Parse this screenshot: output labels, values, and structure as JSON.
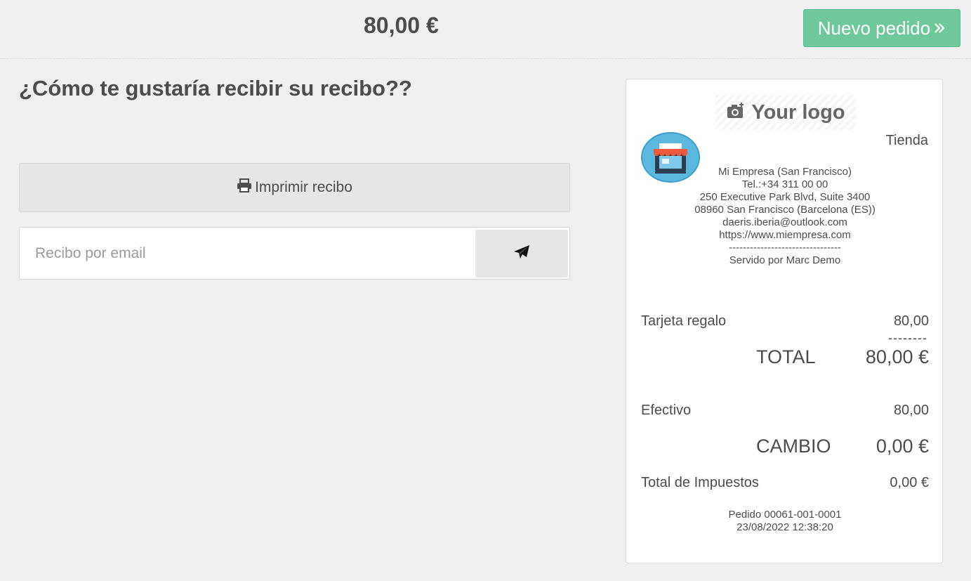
{
  "header": {
    "total": "80,00 €",
    "new_order_label": "Nuevo pedido",
    "new_order_icon": "double-chevron-right-icon"
  },
  "main": {
    "question": "¿Cómo te gustaría recibir su recibo??",
    "print_label": "Imprimir recibo",
    "print_icon": "printer-icon",
    "email_placeholder": "Recibo por email",
    "email_value": "",
    "send_icon": "paper-plane-icon"
  },
  "receipt": {
    "logo_text": "Your logo",
    "logo_icon": "add-photo-icon",
    "shop_name": "Tienda",
    "company_lines": [
      "Mi Empresa (San Francisco)",
      "Tel.:+34 311 00 00",
      "250 Executive Park Blvd, Suite 3400",
      "08960 San Francisco (Barcelona (ES))",
      "daeris.iberia@outlook.com",
      "https://www.miempresa.com",
      "--------------------------------",
      "Servido por Marc Demo"
    ],
    "lines": [
      {
        "product": "Tarjeta regalo",
        "amount": "80,00"
      }
    ],
    "subtotal_dashes": "--------",
    "total_label": "TOTAL",
    "total_value": "80,00 €",
    "payments": [
      {
        "method": "Efectivo",
        "amount": "80,00"
      }
    ],
    "change_label": "CAMBIO",
    "change_value": "0,00 €",
    "tax_label": "Total de Impuestos",
    "tax_value": "0,00 €",
    "order_ref": "Pedido 00061-001-0001",
    "order_date": "23/08/2022 12:38:20"
  },
  "colors": {
    "accent_green": "#6ec89b",
    "background": "#f0efef",
    "text": "#4c4c4c"
  }
}
